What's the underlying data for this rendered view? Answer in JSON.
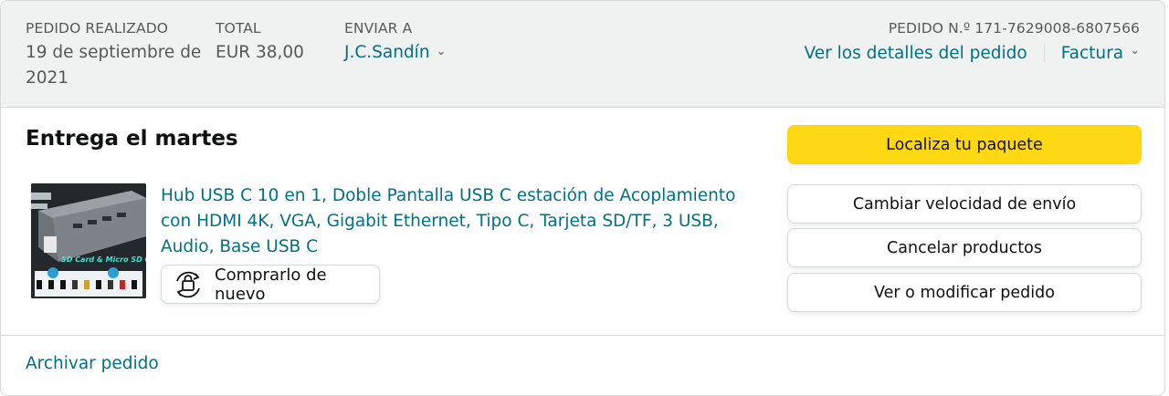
{
  "header": {
    "placed_label": "PEDIDO REALIZADO",
    "placed_value": "19 de septiembre de 2021",
    "total_label": "TOTAL",
    "total_value": "EUR 38,00",
    "ship_to_label": "ENVIAR A",
    "ship_to_value": "J.C.Sandín",
    "order_number": "PEDIDO N.º 171-7629008-6807566",
    "details_link": "Ver los detalles del pedido",
    "invoice_link": "Factura"
  },
  "delivery": {
    "title": "Entrega el martes"
  },
  "product": {
    "title": "Hub USB C 10 en 1, Doble Pantalla USB C estación de Acoplamiento con HDMI 4K, VGA, Gigabit Ethernet, Tipo C, Tarjeta SD/TF, 3 USB, Audio, Base USB C",
    "image_caption": "SD Card & Micro SD Card",
    "buy_again_label": "Comprarlo de nuevo"
  },
  "actions": {
    "track": "Localiza tu paquete",
    "change_speed": "Cambiar velocidad de envío",
    "cancel": "Cancelar productos",
    "modify": "Ver o modificar pedido"
  },
  "footer": {
    "archive": "Archivar pedido"
  },
  "colors": {
    "link": "#007185",
    "primary_button": "#FFD814",
    "header_bg": "#F0F2F2",
    "border": "#D5D9D9"
  }
}
